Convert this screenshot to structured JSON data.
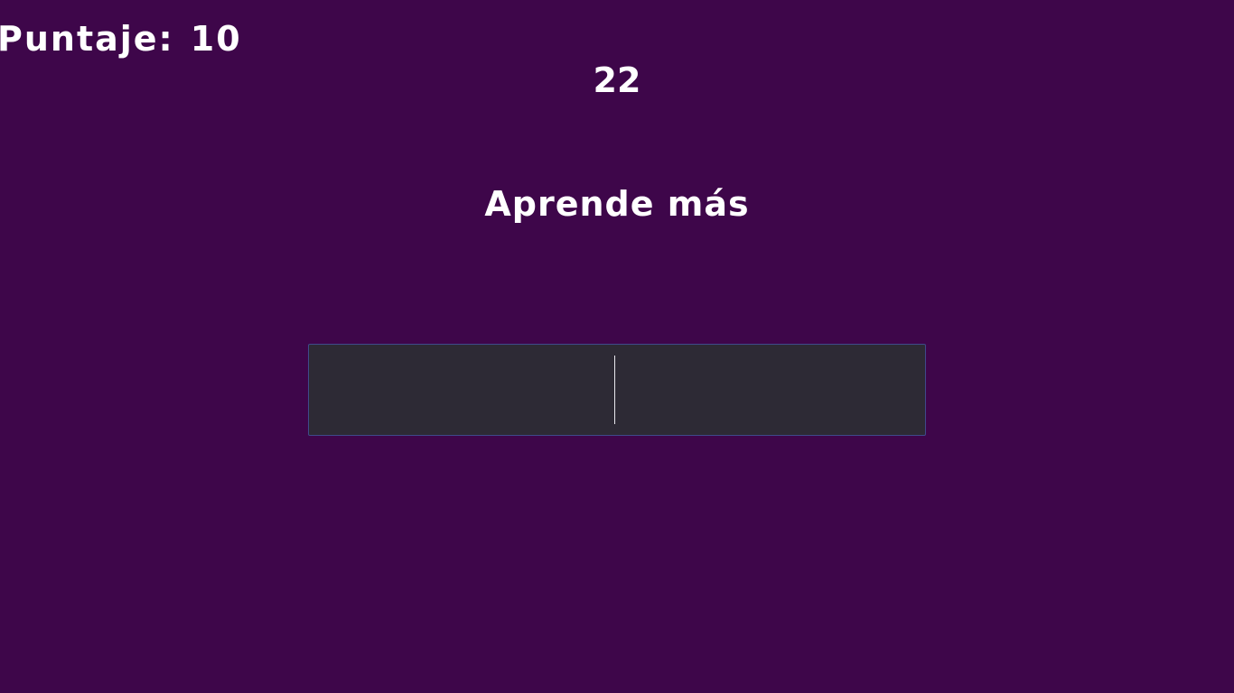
{
  "hud": {
    "score_label": "Puntaje:",
    "score_value": "10",
    "timer": "22"
  },
  "prompt": {
    "text": "Aprende más"
  },
  "answer": {
    "value": ""
  },
  "colors": {
    "background": "#3e064a",
    "text": "#ffffff",
    "input_background": "#2d2a35",
    "input_border": "#3f4a8a"
  }
}
